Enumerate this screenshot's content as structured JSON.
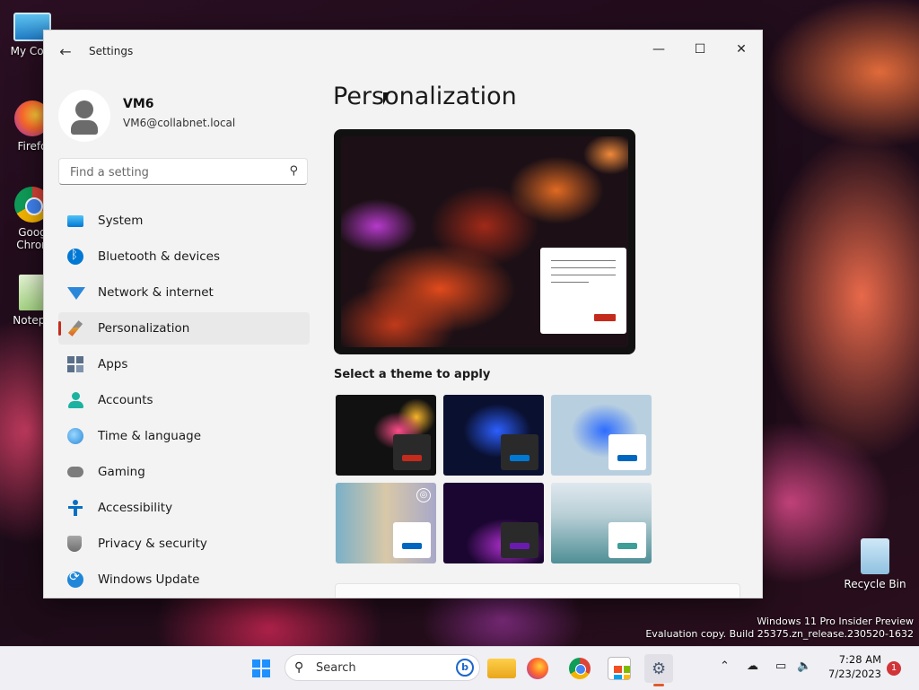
{
  "desktop": {
    "icons": [
      {
        "label": "My Com"
      },
      {
        "label": "Firefo"
      },
      {
        "label": "Goog Chron"
      },
      {
        "label": "Notepa"
      },
      {
        "label": "Recycle Bin"
      }
    ],
    "watermark": {
      "line1": "Windows 11 Pro Insider Preview",
      "line2": "Evaluation copy. Build 25375.zn_release.230520-1632"
    }
  },
  "window": {
    "title": "Settings",
    "back_icon": "arrow-left-icon",
    "controls": {
      "minimize": "—",
      "maximize": "☐",
      "close": "✕"
    }
  },
  "profile": {
    "name": "VM6",
    "email": "VM6@collabnet.local"
  },
  "search": {
    "placeholder": "Find a setting",
    "value": ""
  },
  "nav": {
    "items": [
      {
        "label": "System",
        "icon": "monitor-icon"
      },
      {
        "label": "Bluetooth & devices",
        "icon": "bluetooth-icon"
      },
      {
        "label": "Network & internet",
        "icon": "wifi-icon"
      },
      {
        "label": "Personalization",
        "icon": "brush-icon",
        "selected": true
      },
      {
        "label": "Apps",
        "icon": "apps-icon"
      },
      {
        "label": "Accounts",
        "icon": "person-icon"
      },
      {
        "label": "Time & language",
        "icon": "globe-clock-icon"
      },
      {
        "label": "Gaming",
        "icon": "gamepad-icon"
      },
      {
        "label": "Accessibility",
        "icon": "accessibility-icon"
      },
      {
        "label": "Privacy & security",
        "icon": "shield-icon"
      },
      {
        "label": "Windows Update",
        "icon": "update-icon"
      }
    ]
  },
  "content": {
    "title": "Personalization",
    "theme_heading": "Select a theme to apply",
    "accent_color": "#c42b1c"
  },
  "taskbar": {
    "search_label": "Search",
    "apps": [
      "start",
      "search",
      "file-explorer",
      "firefox",
      "chrome",
      "microsoft-store",
      "settings"
    ],
    "clock": {
      "time": "7:28 AM",
      "date": "7/23/2023"
    },
    "notification_count": "1"
  }
}
